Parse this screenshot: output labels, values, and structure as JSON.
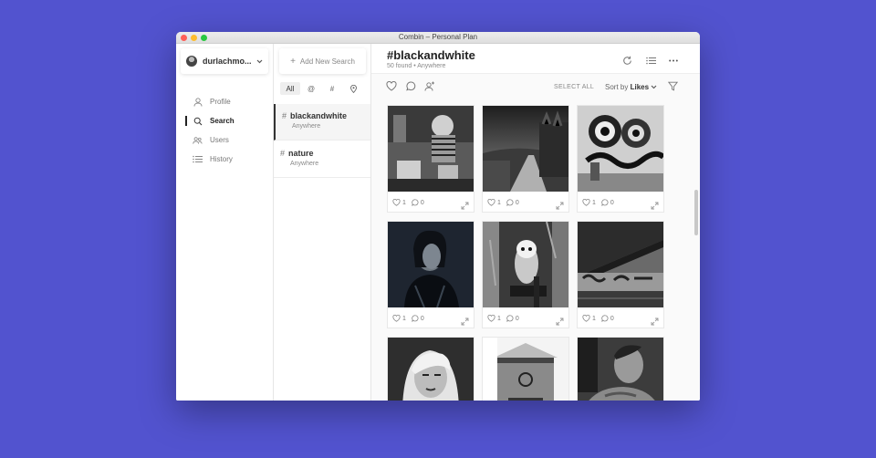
{
  "window": {
    "title": "Combin – Personal Plan"
  },
  "sidebar": {
    "account_name": "durlachmo...",
    "items": [
      {
        "label": "Profile",
        "icon": "user-icon",
        "active": false
      },
      {
        "label": "Search",
        "icon": "search-icon",
        "active": true
      },
      {
        "label": "Users",
        "icon": "users-icon",
        "active": false
      },
      {
        "label": "History",
        "icon": "list-icon",
        "active": false
      }
    ]
  },
  "searches": {
    "add_label": "Add New Search",
    "filters": [
      "All",
      "@",
      "#",
      "location-pin-icon"
    ],
    "items": [
      {
        "name": "blackandwhite",
        "location": "Anywhere",
        "active": true
      },
      {
        "name": "nature",
        "location": "Anywhere",
        "active": false
      }
    ]
  },
  "main": {
    "title": "#blackandwhite",
    "found": "50 found",
    "location": "Anywhere",
    "select_all": "SELECT ALL",
    "sort_label": "Sort by",
    "sort_value": "Likes"
  },
  "posts": [
    {
      "likes": "1",
      "comments": "0",
      "subject": "boy-with-boxes"
    },
    {
      "likes": "1",
      "comments": "0",
      "subject": "country-road"
    },
    {
      "likes": "1",
      "comments": "0",
      "subject": "graffiti-wall"
    },
    {
      "likes": "1",
      "comments": "0",
      "subject": "woman-portrait"
    },
    {
      "likes": "1",
      "comments": "0",
      "subject": "owl"
    },
    {
      "likes": "1",
      "comments": "0",
      "subject": "bridge-graffiti"
    },
    {
      "likes": "",
      "comments": "",
      "subject": "woman-selfie"
    },
    {
      "likes": "",
      "comments": "",
      "subject": "building"
    },
    {
      "likes": "",
      "comments": "",
      "subject": "man-portrait"
    }
  ]
}
